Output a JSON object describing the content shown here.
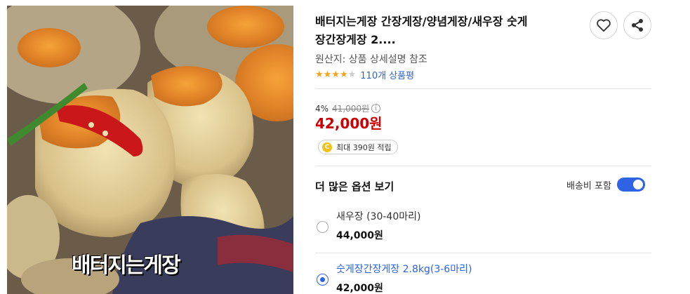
{
  "product": {
    "image_alt": "배터지는게장",
    "watermark": "배터지는게장",
    "title_line1": "배터지는게장 간장게장/양념게장/새우장 숫게",
    "title_line2": "장간장게장 2....",
    "origin": "원산지: 상품 상세설명 참조",
    "rating": 4,
    "rating_max": 5,
    "review_count_text": "110개 상품평"
  },
  "actions": {
    "wishlist_icon": "heart-icon",
    "share_icon": "share-icon"
  },
  "price": {
    "discount_rate": "4%",
    "original_price": "41,000원",
    "sale_price": "42,000원",
    "point_coin": "C",
    "point_text": "최대 390원 적립"
  },
  "options": {
    "header": "더 많은 옵션 보기",
    "shipping_label": "배송비 포함",
    "shipping_toggle_on": true,
    "items": [
      {
        "name": "새우장 (30-40마리)",
        "price": "44,000원",
        "selected": false
      },
      {
        "name": "숫게장간장게장 2.8kg(3-6마리)",
        "price": "42,000원",
        "selected": true
      }
    ]
  },
  "colors": {
    "sale_price": "#cc0000",
    "link_blue": "#2e63c6",
    "accent": "#2e63e6",
    "star": "#f7a31c"
  }
}
